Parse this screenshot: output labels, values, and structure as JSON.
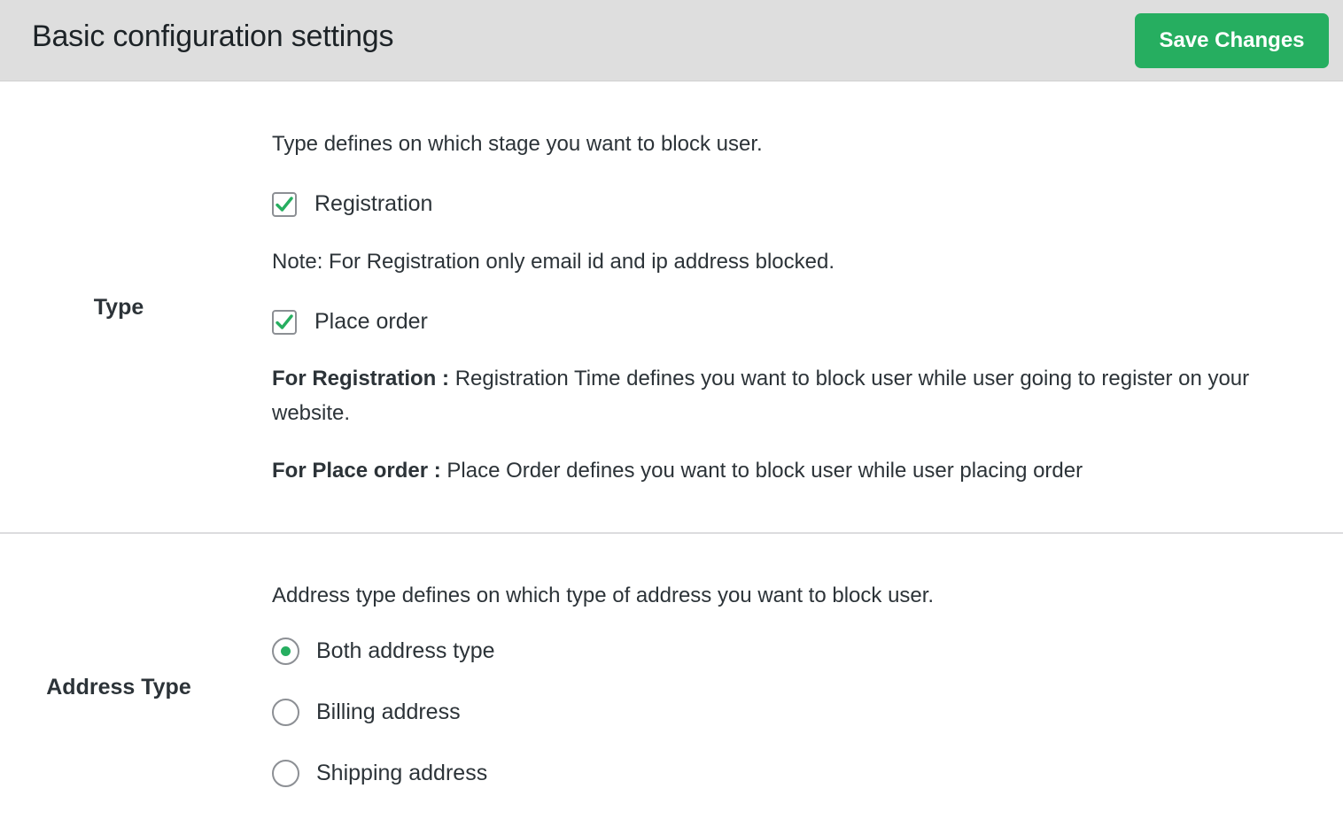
{
  "header": {
    "title": "Basic configuration settings",
    "save_label": "Save Changes"
  },
  "type_section": {
    "label": "Type",
    "description": "Type defines on which stage you want to block user.",
    "options": [
      {
        "label": "Registration",
        "checked": true
      },
      {
        "label": "Place order",
        "checked": true
      }
    ],
    "note": "Note: For Registration only email id and ip address blocked.",
    "registration_help_title": "For Registration :",
    "registration_help_text": "Registration Time defines you want to block user while user going to register on your website.",
    "place_order_help_title": "For Place order :",
    "place_order_help_text": "Place Order defines you want to block user while user placing order"
  },
  "address_section": {
    "label": "Address Type",
    "description": "Address type defines on which type of address you want to block user.",
    "options": [
      {
        "label": "Both address type",
        "selected": true
      },
      {
        "label": "Billing address",
        "selected": false
      },
      {
        "label": "Shipping address",
        "selected": false
      }
    ]
  },
  "colors": {
    "accent": "#26ae60",
    "header_bg": "#dedede",
    "text": "#2c3338"
  }
}
